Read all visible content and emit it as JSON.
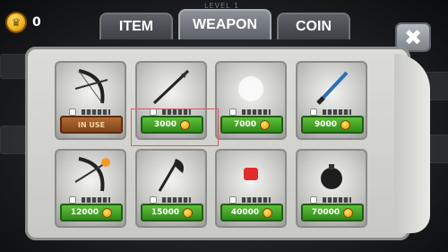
{
  "header": {
    "coin_count": "0",
    "level_label": "LEVEL 1"
  },
  "tabs": [
    {
      "label": "ITEM",
      "active": false
    },
    {
      "label": "WEAPON",
      "active": true
    },
    {
      "label": "COIN",
      "active": false
    }
  ],
  "close_label": "✖",
  "weapons": [
    {
      "icon": "bow-icon",
      "button": "IN USE",
      "state": "equipped"
    },
    {
      "icon": "spear-icon",
      "button": "3000",
      "state": "buy"
    },
    {
      "icon": "hidden-icon",
      "button": "7000",
      "state": "buy"
    },
    {
      "icon": "blue-sword-icon",
      "button": "9000",
      "state": "buy"
    },
    {
      "icon": "fire-crossbow-icon",
      "button": "12000",
      "state": "buy"
    },
    {
      "icon": "axe-icon",
      "button": "15000",
      "state": "buy"
    },
    {
      "icon": "red-gem-icon",
      "button": "40000",
      "state": "buy"
    },
    {
      "icon": "bomb-icon",
      "button": "70000",
      "state": "buy"
    }
  ],
  "colors": {
    "buy_button": "#3fa428",
    "in_use_button": "#9a5427",
    "highlight": "#e05a5a"
  }
}
